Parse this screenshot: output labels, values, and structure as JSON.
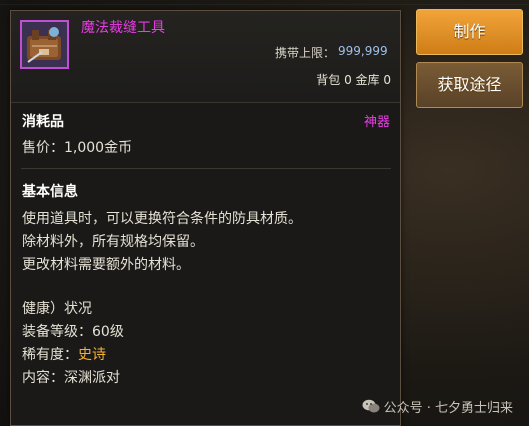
{
  "item": {
    "name": "魔法裁缝工具",
    "carry_label": "携带上限：",
    "carry_value": "999,999",
    "storage_text": "背包 0 金库 0",
    "category": "消耗品",
    "grade": "神器",
    "price": "售价：1,000金币",
    "section_title": "基本信息",
    "description": [
      "使用道具时，可以更换符合条件的防具材质。",
      "除材料外，所有规格均保留。",
      "更改材料需要额外的材料。"
    ],
    "status_line": "健康）状况",
    "level_line": "装备等级：60级",
    "rarity_label": "稀有度：",
    "rarity_value": "史诗",
    "content_line": "内容：深渊派对"
  },
  "buttons": {
    "craft": "制作",
    "source": "获取途径"
  },
  "watermark": "公众号 · 七夕勇士归来",
  "colors": {
    "item_name": "#e93de5",
    "rarity": "#f5b331",
    "carry_value": "#9fc0ea",
    "craft_button": "#e39224"
  },
  "icons": {
    "item": "tailor-kit-icon",
    "watermark": "wechat-icon"
  }
}
